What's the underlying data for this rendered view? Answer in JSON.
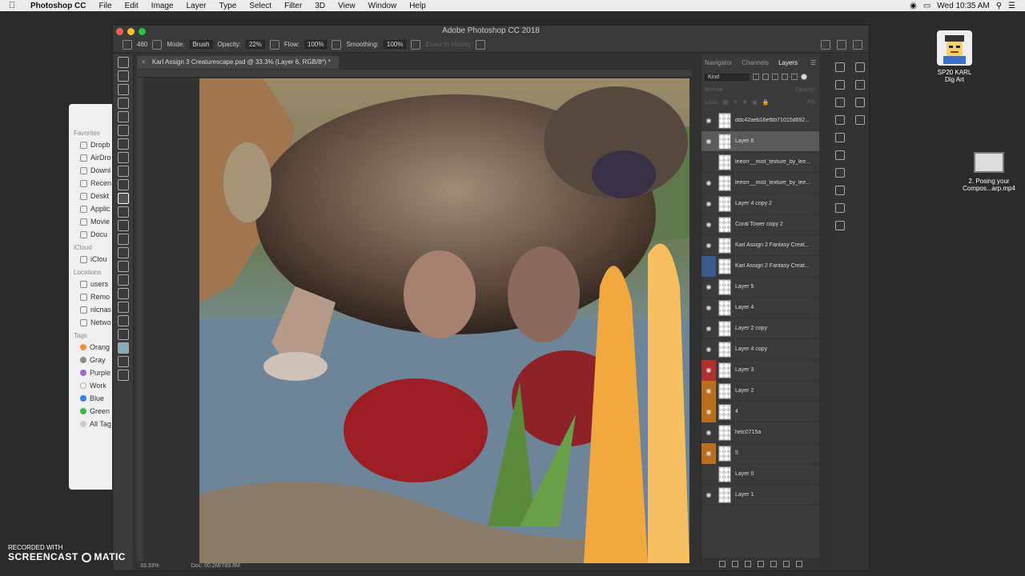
{
  "menubar": {
    "app_name": "Photoshop CC",
    "items": [
      "File",
      "Edit",
      "Image",
      "Layer",
      "Type",
      "Select",
      "Filter",
      "3D",
      "View",
      "Window",
      "Help"
    ],
    "clock": "Wed 10:35 AM"
  },
  "finder": {
    "favorites_label": "Favorites",
    "favorites": [
      "Dropb",
      "AirDro",
      "Downl",
      "Recen",
      "Deskt",
      "Applic",
      "Movie",
      "Docu"
    ],
    "icloud_label": "iCloud",
    "icloud": [
      "iClou"
    ],
    "locations_label": "Locations",
    "locations": [
      "users",
      "Remo",
      "nlcnas",
      "Netwo"
    ],
    "tags_label": "Tags",
    "tags": [
      {
        "label": "Orang",
        "color": "#f0913a"
      },
      {
        "label": "Gray",
        "color": "#8e8e8e"
      },
      {
        "label": "Purple",
        "color": "#a463c8"
      },
      {
        "label": "Work",
        "color": "#ffffff"
      },
      {
        "label": "Blue",
        "color": "#3b7de8"
      },
      {
        "label": "Green",
        "color": "#3fb54a"
      },
      {
        "label": "All Tag",
        "color": "#cccccc"
      }
    ]
  },
  "ps": {
    "window_title": "Adobe Photoshop CC 2018",
    "options": {
      "brush_size": "460",
      "mode_label": "Mode:",
      "mode_value": "Brush",
      "opacity_label": "Opacity:",
      "opacity_value": "22%",
      "flow_label": "Flow:",
      "flow_value": "100%",
      "smoothing_label": "Smoothing:",
      "smoothing_value": "100%",
      "erase_history": "Erase to History"
    },
    "doc_tab": "Karl Assign 3 Creaturescape.psd @ 33.3% (Layer 6, RGB/8*) *",
    "zoom": "33.33%",
    "doc_size": "Doc: 60.2M/789.8M"
  },
  "panel": {
    "tabs": [
      "Navigator",
      "Channels",
      "Layers"
    ],
    "active_tab": "Layers",
    "filter_kind": "Kind",
    "blend_mode": "Normal",
    "opacity_label": "Opacity:",
    "lock_label": "Lock:",
    "fill_label": "Fill:",
    "layers": [
      {
        "name": "ddc42aeb16efbb71015d692...",
        "eye": true,
        "tag": ""
      },
      {
        "name": "Layer 6",
        "eye": true,
        "tag": "",
        "selected": true
      },
      {
        "name": "leeorr__mist_texture_by_lee...",
        "eye": false,
        "tag": ""
      },
      {
        "name": "leeorr__mist_texture_by_lee...",
        "eye": true,
        "tag": ""
      },
      {
        "name": "Layer 4 copy 2",
        "eye": true,
        "tag": ""
      },
      {
        "name": "Coral Tower copy 2",
        "eye": true,
        "tag": ""
      },
      {
        "name": "Karl Assign 2 Fantasy Creat...",
        "eye": true,
        "tag": ""
      },
      {
        "name": "Karl Assign 2 Fantasy Creat...",
        "eye": false,
        "tag": "#3a5a8a"
      },
      {
        "name": "Layer 5",
        "eye": true,
        "tag": ""
      },
      {
        "name": "Layer 4",
        "eye": true,
        "tag": ""
      },
      {
        "name": "Layer 2 copy",
        "eye": true,
        "tag": ""
      },
      {
        "name": "Layer 4 copy",
        "eye": true,
        "tag": ""
      },
      {
        "name": "Layer 3",
        "eye": true,
        "tag": "#b03030"
      },
      {
        "name": "Layer 2",
        "eye": true,
        "tag": "#b8701e"
      },
      {
        "name": "4",
        "eye": true,
        "tag": "#b8701e"
      },
      {
        "name": "helc0715a",
        "eye": true,
        "tag": ""
      },
      {
        "name": "5",
        "eye": true,
        "tag": "#b8701e"
      },
      {
        "name": "Layer 0",
        "eye": false,
        "tag": ""
      },
      {
        "name": "Layer 1",
        "eye": true,
        "tag": ""
      }
    ]
  },
  "desktop": {
    "icon1_label_line1": "SP20 KARL",
    "icon1_label_line2": "Dig Art",
    "icon2_label": "2. Posing your Compos...arp.mp4"
  },
  "watermark": {
    "line1": "RECORDED WITH",
    "line2": "SCREENCAST",
    "line3": "MATIC"
  }
}
